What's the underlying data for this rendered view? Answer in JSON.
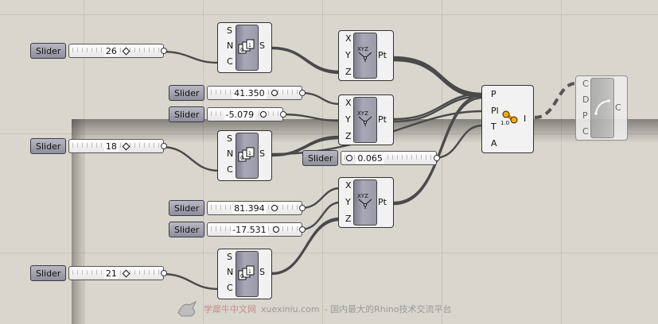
{
  "canvas": {
    "background": "#d9d6cd",
    "group_fill": "#d4d0c6",
    "wire_color": "#4a4a4a"
  },
  "sliders": [
    {
      "name": "slider-n-top",
      "tag": "Slider",
      "value": "26"
    },
    {
      "name": "slider-x-mid",
      "tag": "Slider",
      "value": "41.350"
    },
    {
      "name": "slider-y-mid",
      "tag": "Slider",
      "value": "-5.079"
    },
    {
      "name": "slider-n-mid",
      "tag": "Slider",
      "value": "18"
    },
    {
      "name": "slider-t",
      "tag": "Slider",
      "value": "0.065"
    },
    {
      "name": "slider-x-bot",
      "tag": "Slider",
      "value": "81.394"
    },
    {
      "name": "slider-y-bot",
      "tag": "Slider",
      "value": "-17.531"
    },
    {
      "name": "slider-n-bot",
      "tag": "Slider",
      "value": "21"
    }
  ],
  "series_component": {
    "inputs": [
      "S",
      "N",
      "C"
    ],
    "output": "S",
    "icon": "series-icon"
  },
  "point_component": {
    "inputs": [
      "X",
      "Y",
      "Z"
    ],
    "output": "Pt",
    "icon_text": "XYZ",
    "icon": "construct-point-icon"
  },
  "interp_component": {
    "inputs": [
      "P",
      "Pl",
      "T",
      "A"
    ],
    "output": "I",
    "degree_label": "1.0",
    "icon": "interpolate-curve-icon"
  },
  "ghost_component": {
    "inputs": [
      "C",
      "D",
      "P",
      "C"
    ],
    "output": "C",
    "icon": "arc-curve-icon"
  },
  "watermark": {
    "logo": "rhino-logo-icon",
    "cn_brand": "学犀牛中文网",
    "domain": "xuexiniu.com",
    "tagline": "- 国内最大的Rhino技术交流平台"
  }
}
